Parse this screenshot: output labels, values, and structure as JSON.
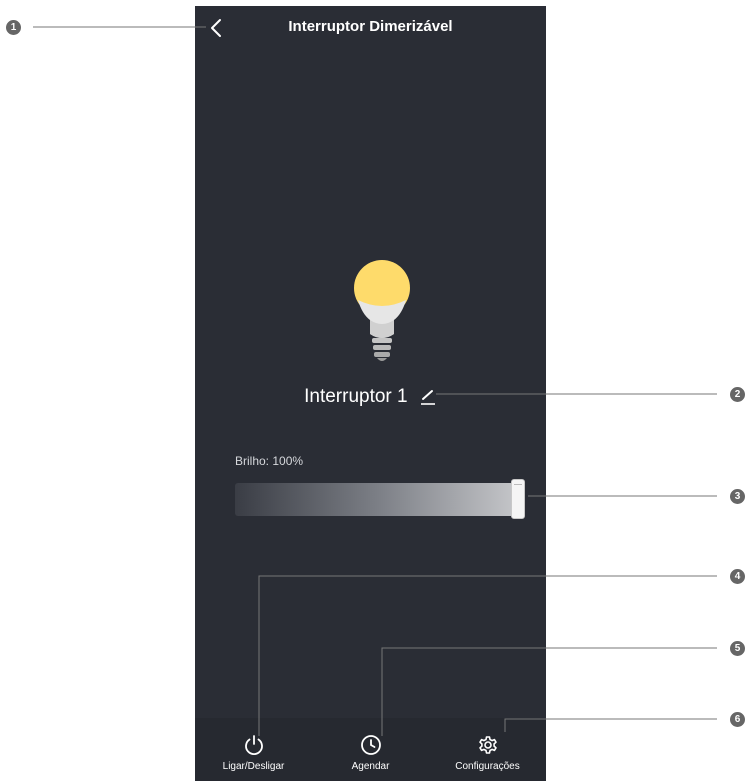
{
  "header": {
    "back_icon": "chevron-left-icon",
    "title": "Interruptor Dimerizável"
  },
  "device": {
    "bulb_icon": "light-bulb-icon",
    "bulb_color": "#fedb6b",
    "name": "Interruptor 1",
    "edit_icon": "pencil-edit-icon"
  },
  "brightness": {
    "label": "Brilho: 100%",
    "value_percent": 100
  },
  "bottom_tabs": [
    {
      "label": "Ligar/Desligar",
      "icon": "power-icon"
    },
    {
      "label": "Agendar",
      "icon": "clock-icon"
    },
    {
      "label": "Configurações",
      "icon": "gear-icon"
    }
  ],
  "callouts": [
    "1",
    "2",
    "3",
    "4",
    "5",
    "6"
  ],
  "colors": {
    "background": "#2a2d35",
    "text": "#ffffff",
    "callout": "#666666"
  }
}
